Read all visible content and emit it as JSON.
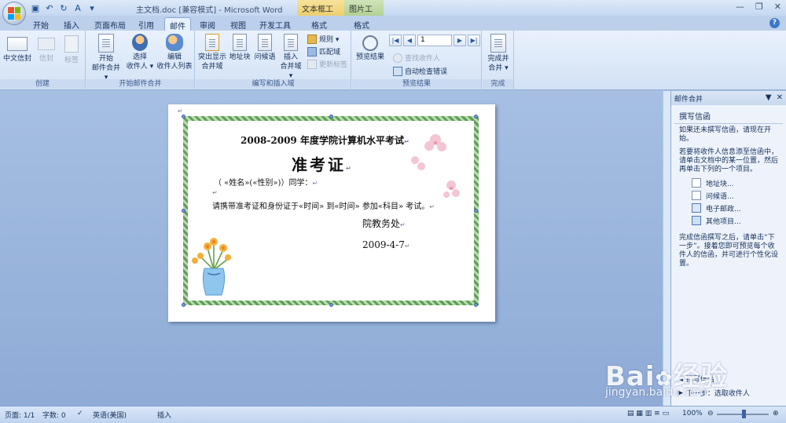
{
  "window": {
    "title": "主文档.doc [兼容模式] - Microsoft Word",
    "context_tab_textbox": "文本框工具",
    "context_tab_picture": "图片工具"
  },
  "tabs": [
    "开始",
    "插入",
    "页面布局",
    "引用",
    "邮件",
    "审阅",
    "视图",
    "开发工具",
    "格式",
    "格式"
  ],
  "active_tab": "邮件",
  "ribbon": {
    "groups": {
      "create": "创建",
      "start_merge": "开始邮件合并",
      "write_insert": "编写和插入域",
      "preview": "预览结果",
      "finish": "完成"
    },
    "create": {
      "chinese_envelope": "中文信封",
      "envelope": "信封",
      "labels": "标签"
    },
    "start_merge": {
      "start_line1": "开始",
      "start_line2": "邮件合并 ▾",
      "select_line1": "选择",
      "select_line2": "收件人 ▾",
      "edit_line1": "编辑",
      "edit_line2": "收件人列表"
    },
    "write_insert": {
      "highlight_line1": "突出显示",
      "highlight_line2": "合并域",
      "address_block": "地址块",
      "greeting": "问候语",
      "insert_line1": "插入",
      "insert_line2": "合并域 ▾",
      "rules": "规则 ▾",
      "match_fields": "匹配域",
      "update_labels": "更新标签"
    },
    "preview": {
      "preview_results": "预览结果",
      "record_value": "1",
      "find_recipient": "查找收件人",
      "auto_check": "自动检查错误"
    },
    "finish": {
      "line1": "完成并",
      "line2": "合并 ▾"
    }
  },
  "document": {
    "heading": "2008-2009 年度学院计算机水平考试",
    "title": "准考证",
    "line1": "（ «姓名»(«性别»)）同学：",
    "line2": "请携带准考证和身份证于«时间» 到«时间» 参加«科目» 考试。",
    "signature": "院教务处",
    "date": "2009-4-7"
  },
  "task_pane": {
    "header": "邮件合并",
    "section_title": "撰写信函",
    "intro": "如果还未撰写信函，请现在开始。",
    "instructions": "若要将收件人信息添至信函中，请单击文档中的某一位置，然后再单击下列的一个项目。",
    "items": [
      "地址块...",
      "问候语...",
      "电子邮政...",
      "其他项目..."
    ],
    "after_text": "完成信函撰写之后，请单击“下一步”。接着您即可预览每个收件人的信函，并可进行个性化设置。",
    "step_prev": "撰写信函",
    "step_next": "下一步：选取收件人"
  },
  "statusbar": {
    "page": "页面: 1/1",
    "words": "字数: 0",
    "language": "英语(美国)",
    "mode": "插入",
    "zoom": "100%"
  },
  "watermark": {
    "brand": "Bai\u0001经验",
    "url": "jingyan.baidu.com"
  }
}
